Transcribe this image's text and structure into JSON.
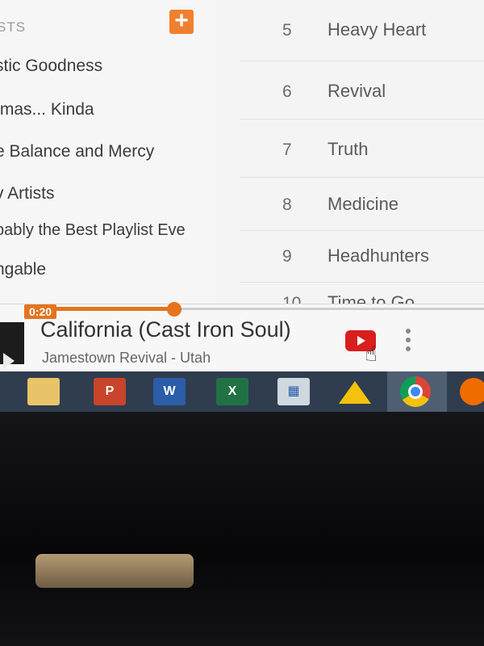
{
  "sidebar": {
    "header": "STS",
    "add_button": "+",
    "playlists": [
      "stic Goodness",
      "tmas... Kinda",
      "e Balance and Mercy",
      "v Artists",
      "bably the Best Playlist Eve",
      "ngable"
    ]
  },
  "tracks": [
    {
      "num": "5",
      "title": "Heavy Heart"
    },
    {
      "num": "6",
      "title": "Revival"
    },
    {
      "num": "7",
      "title": "Truth"
    },
    {
      "num": "8",
      "title": "Medicine"
    },
    {
      "num": "9",
      "title": "Headhunters"
    },
    {
      "num": "10",
      "title": "Time to Go"
    }
  ],
  "player": {
    "elapsed": "0:20",
    "song_title": "California (Cast Iron Soul)",
    "artist_album": "Jamestown Revival - Utah",
    "progress_fraction": 0.32,
    "icons": [
      "youtube-icon",
      "hand-cursor-icon",
      "more-vert-icon"
    ]
  },
  "taskbar": {
    "apps": [
      {
        "name": "file-explorer-icon"
      },
      {
        "name": "powerpoint-icon",
        "label": "P"
      },
      {
        "name": "word-icon",
        "label": "W"
      },
      {
        "name": "excel-icon",
        "label": "X"
      },
      {
        "name": "calculator-icon"
      },
      {
        "name": "google-drive-icon"
      },
      {
        "name": "chrome-icon"
      },
      {
        "name": "google-play-music-icon"
      }
    ]
  },
  "colors": {
    "accent": "#e4741e",
    "youtube": "#d91e1e",
    "taskbar": "#2f3d4f"
  }
}
